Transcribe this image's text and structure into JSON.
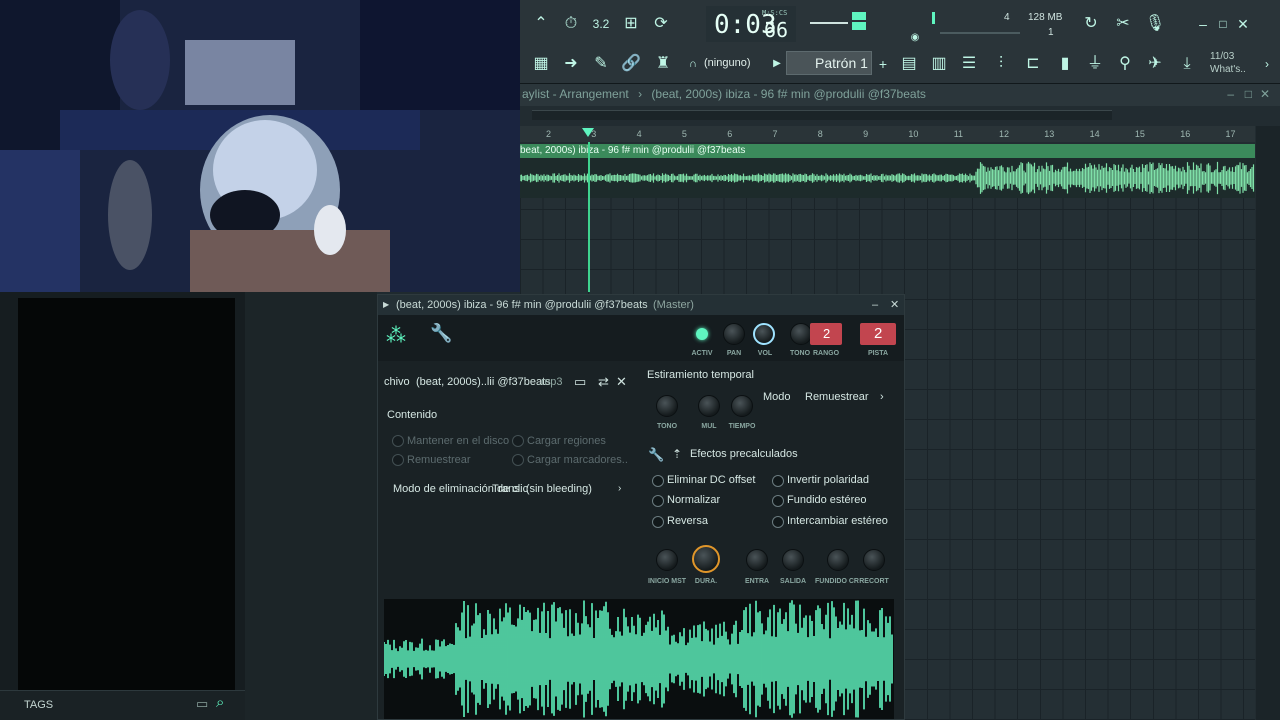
{
  "toolbar": {
    "time": "0:03",
    "time_cs": "66",
    "time_unit": "M:S:CS",
    "cpu_value": "4",
    "memory": "128 MB",
    "poly": "1",
    "pattern_label": "Patrón 1",
    "none_label": "(ninguno)",
    "hint_date": "11/03",
    "hint_text": "What's.."
  },
  "playlist": {
    "title": "aylist - Arrangement",
    "breadcrumb_sep": "›",
    "track_name": "(beat, 2000s) ibiza - 96 f# min @produlii @f37beats",
    "clip_label": "beat, 2000s) ibiza - 96 f# min @produlii @f37beats",
    "ruler": [
      "2",
      "3",
      "4",
      "5",
      "6",
      "7",
      "8",
      "9",
      "10",
      "11",
      "12",
      "13",
      "14",
      "15",
      "16",
      "17"
    ]
  },
  "browser": {
    "tags_label": "TAGS"
  },
  "sampler": {
    "title": "(beat, 2000s) ibiza - 96 f# min @produlii @f37beats",
    "title_suffix": "(Master)",
    "knobs_top": [
      "ACTIV",
      "PAN",
      "VOL",
      "TONO",
      "RANGO",
      "PISTA"
    ],
    "range_value": "2",
    "track_value": "2",
    "file_prefix": "chivo",
    "file_name": "(beat, 2000s)..lii @f37beats",
    "file_ext": ".mp3",
    "content_heading": "Contenido",
    "opt_keep": "Mantener en el disco",
    "opt_load_regions": "Cargar regiones",
    "opt_resample": "Remuestrear",
    "opt_load_markers": "Cargar marcadores..",
    "declick_label": "Modo de eliminación de clic",
    "declick_value": "Trans. (sin bleeding)",
    "stretch_heading": "Estiramiento temporal",
    "mode_label": "Modo",
    "mode_value": "Remuestrear",
    "stretch_knobs": [
      "TONO",
      "MUL",
      "TIEMPO"
    ],
    "precalc_heading": "Efectos precalculados",
    "fx_left": [
      "Eliminar DC offset",
      "Normalizar",
      "Reversa"
    ],
    "fx_right": [
      "Invertir polaridad",
      "Fundido estéreo",
      "Intercambiar estéreo"
    ],
    "bottom_knobs": [
      "INICIO MST",
      "DURA.",
      "ENTRA",
      "SALIDA",
      "FUNDIDO CR",
      "RECORT"
    ]
  },
  "colors": {
    "accent_green": "#5ff5c0",
    "clip_green": "#3b8a5b",
    "badge_red": "#c2454f",
    "knob_orange": "#e0962a"
  }
}
